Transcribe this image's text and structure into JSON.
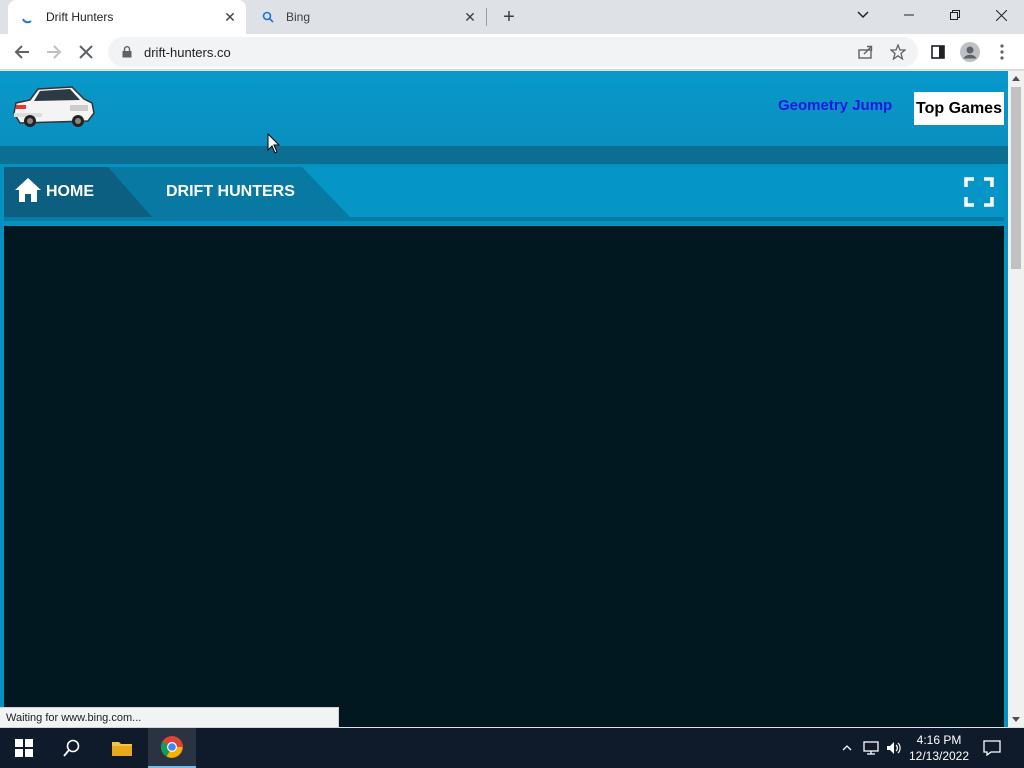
{
  "browser": {
    "tabs": [
      {
        "title": "Drift Hunters",
        "active": true
      },
      {
        "title": "Bing",
        "active": false
      }
    ],
    "url": "drift-hunters.co",
    "status": "Waiting for www.bing.com..."
  },
  "site": {
    "header_link": "Geometry Jump",
    "header_button": "Top Games",
    "nav": {
      "home": "HOME",
      "current": "DRIFT HUNTERS"
    }
  },
  "taskbar": {
    "time": "4:16 PM",
    "date": "12/13/2022"
  },
  "colors": {
    "site_primary": "#0592c1",
    "nav_dark": "#0c5f80",
    "game_bg": "#021821",
    "link_blue": "#1a1ae0"
  }
}
